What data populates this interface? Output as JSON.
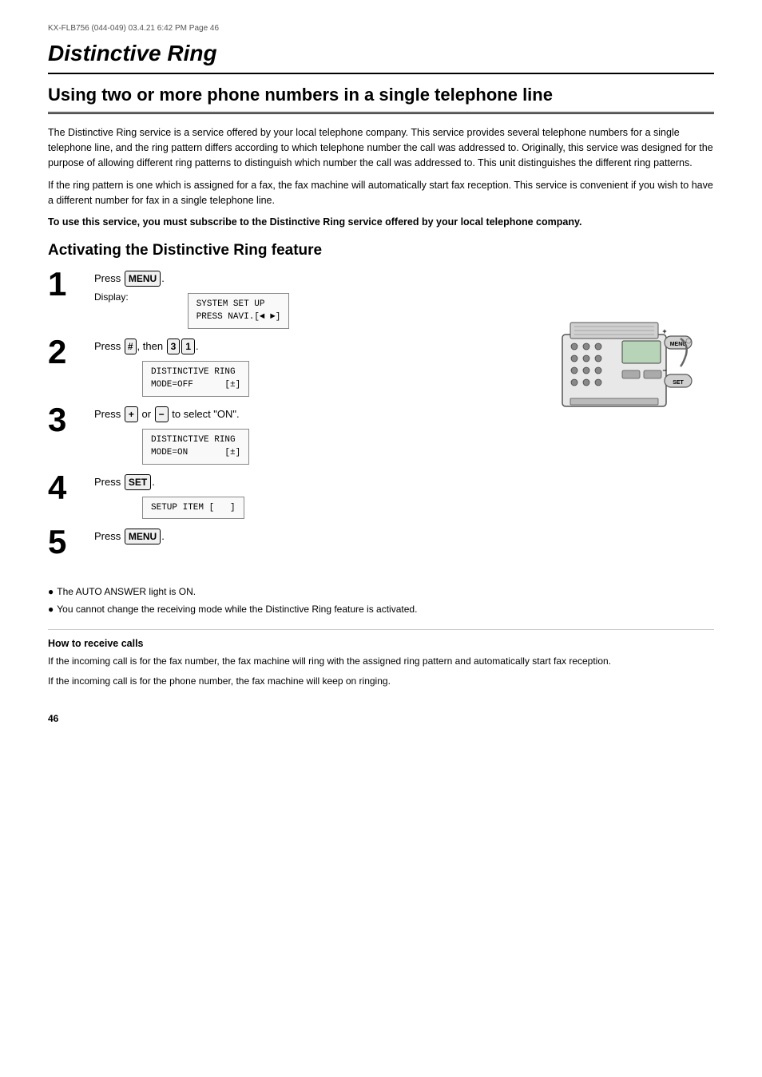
{
  "file_info": "KX-FLB756 (044-049)  03.4.21  6:42 PM  Page 46",
  "page_title": "Distinctive Ring",
  "section_heading": "Using two or more phone numbers in a single telephone line",
  "body_paragraphs": [
    "The Distinctive Ring service is a service offered by your local telephone company. This service provides several telephone numbers for a single telephone line, and the ring pattern differs according to which telephone number the call was addressed to. Originally, this service was designed for the purpose of allowing different ring patterns to distinguish which number the call was addressed to. This unit distinguishes the different ring patterns.",
    "If the ring pattern is one which is assigned for a fax, the fax machine will automatically start fax reception. This service is convenient if you wish to have a different number for fax in a single telephone line."
  ],
  "bold_note": "To use this service, you must subscribe to the Distinctive Ring service offered by your local telephone company.",
  "activating_heading": "Activating the Distinctive Ring feature",
  "steps": [
    {
      "number": "1",
      "instruction": "Press [MENU].",
      "has_display": true,
      "display_label": "Display:",
      "display_lines": [
        "SYSTEM SET UP",
        "PRESS NAVI.[◄ ►]"
      ]
    },
    {
      "number": "2",
      "instruction": "Press [#], then [3][1].",
      "has_display": true,
      "display_label": "",
      "display_lines": [
        "DISTINCTIVE RING",
        "MODE=OFF      [±]"
      ]
    },
    {
      "number": "3",
      "instruction": "Press [+] or [−] to select \"ON\".",
      "has_display": true,
      "display_label": "",
      "display_lines": [
        "DISTINCTIVE RING",
        "MODE=ON       [±]"
      ]
    },
    {
      "number": "4",
      "instruction": "Press [SET].",
      "has_display": true,
      "display_label": "",
      "display_lines": [
        "SETUP ITEM [   ]"
      ]
    },
    {
      "number": "5",
      "instruction": "Press [MENU].",
      "has_display": false,
      "display_label": "",
      "display_lines": []
    }
  ],
  "notes": [
    "The AUTO ANSWER light is ON.",
    "You cannot change the receiving mode while the Distinctive Ring feature is activated."
  ],
  "how_to_title": "How to receive calls",
  "how_to_paragraphs": [
    "If the incoming call is for the fax number, the fax machine will ring with the assigned ring pattern and automatically start fax reception.",
    "If the incoming call is for the phone number, the fax machine will keep on ringing."
  ],
  "page_number": "46",
  "keys": {
    "menu": "MENU",
    "set": "SET",
    "plus": "+",
    "minus": "−",
    "hash": "#"
  }
}
